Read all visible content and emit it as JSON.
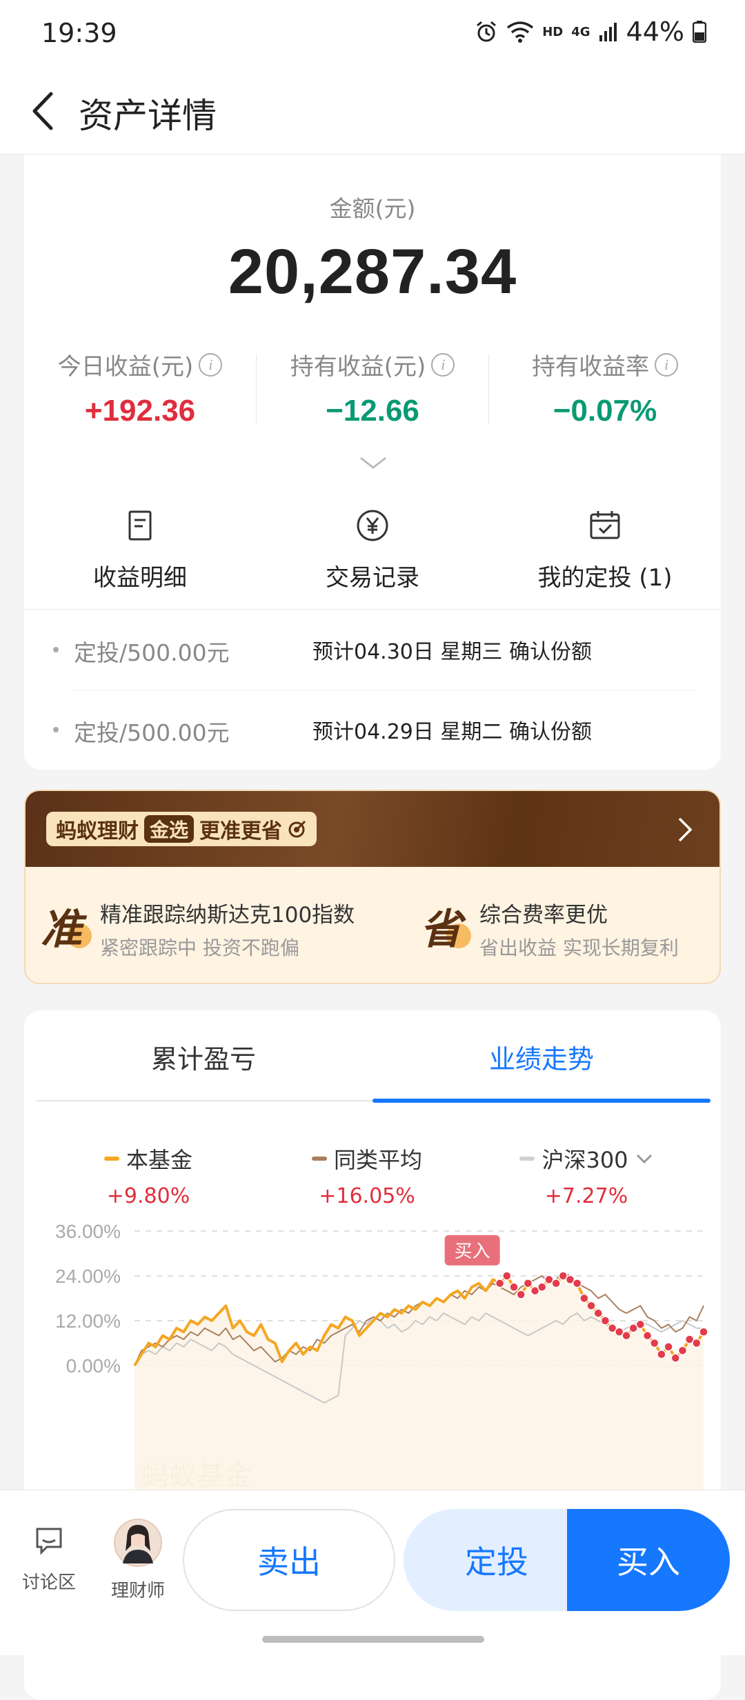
{
  "status": {
    "time": "19:39",
    "hd": "HD",
    "net": "4G",
    "battery": "44%"
  },
  "nav": {
    "title": "资产详情"
  },
  "asset": {
    "amount_label": "金额(元)",
    "amount": "20,287.34",
    "metrics": [
      {
        "label": "今日收益(元)",
        "value": "+192.36",
        "tone": "red"
      },
      {
        "label": "持有收益(元)",
        "value": "−12.66",
        "tone": "green"
      },
      {
        "label": "持有收益率",
        "value": "−0.07%",
        "tone": "green"
      }
    ],
    "actions": [
      {
        "label": "收益明细",
        "icon": "document-icon"
      },
      {
        "label": "交易记录",
        "icon": "yuan-icon"
      },
      {
        "label": "我的定投 (1)",
        "icon": "calendar-check-icon"
      }
    ],
    "plans": [
      {
        "amount": "定投/500.00元",
        "note": "预计04.30日 星期三 确认份额"
      },
      {
        "amount": "定投/500.00元",
        "note": "预计04.29日 星期二 确认份额"
      }
    ]
  },
  "promo": {
    "brand": "蚂蚁理财",
    "badge": "金选",
    "slogan": "更准更省",
    "features": [
      {
        "char": "准",
        "title": "精准跟踪纳斯达克100指数",
        "desc": "紧密跟踪中 投资不跑偏"
      },
      {
        "char": "省",
        "title": "综合费率更优",
        "desc": "省出收益 实现长期复利"
      }
    ]
  },
  "perf": {
    "tabs": [
      "累计盈亏",
      "业绩走势"
    ],
    "active_tab": 1,
    "legend": [
      {
        "name": "本基金",
        "pct": "+9.80%",
        "color": "#f5a623"
      },
      {
        "name": "同类平均",
        "pct": "+16.05%",
        "color": "#a87f5e"
      },
      {
        "name": "沪深300",
        "pct": "+7.27%",
        "color": "#c8c8c8"
      }
    ],
    "buy_marker": "买入",
    "watermark": "蚂蚁基金"
  },
  "chart_data": {
    "type": "line",
    "y_ticks": [
      "36.00%",
      "24.00%",
      "12.00%",
      "0.00%"
    ],
    "ylim": [
      0,
      36
    ],
    "grid": true,
    "series": [
      {
        "name": "本基金",
        "color": "#f5a623",
        "values": [
          0,
          3,
          6,
          5,
          8,
          7,
          10,
          9,
          12,
          11,
          13,
          12,
          14,
          16,
          10,
          12,
          9,
          8,
          11,
          7,
          6,
          1,
          4,
          6,
          3,
          5,
          4,
          8,
          11,
          10,
          13,
          12,
          8,
          10,
          12,
          14,
          13,
          15,
          14,
          16,
          15,
          17,
          16,
          18,
          17,
          19,
          20,
          18,
          21,
          22,
          20,
          23,
          22,
          24,
          21,
          19,
          22,
          20,
          21,
          23,
          22,
          24,
          23,
          22,
          18,
          16,
          14,
          12,
          10,
          9,
          8,
          10,
          11,
          8,
          6,
          3,
          5,
          2,
          4,
          7,
          6,
          9
        ]
      },
      {
        "name": "同类平均",
        "color": "#a87f5e",
        "values": [
          0,
          4,
          5,
          6,
          5,
          7,
          8,
          7,
          9,
          8,
          10,
          9,
          8,
          10,
          7,
          8,
          6,
          4,
          5,
          3,
          1,
          2,
          4,
          3,
          5,
          4,
          7,
          6,
          8,
          9,
          10,
          11,
          9,
          12,
          13,
          12,
          14,
          13,
          15,
          14,
          16,
          17,
          16,
          18,
          17,
          19,
          18,
          20,
          19,
          21,
          20,
          22,
          21,
          20,
          19,
          21,
          22,
          23,
          24,
          22,
          23,
          25,
          24,
          22,
          21,
          20,
          18,
          19,
          17,
          15,
          14,
          15,
          16,
          13,
          12,
          10,
          11,
          9,
          10,
          13,
          12,
          16
        ]
      },
      {
        "name": "沪深300",
        "color": "#c8c8c8",
        "values": [
          0,
          3,
          4,
          3,
          5,
          4,
          6,
          5,
          7,
          6,
          5,
          4,
          6,
          5,
          3,
          2,
          1,
          0,
          -1,
          -2,
          -3,
          -4,
          -5,
          -6,
          -7,
          -8,
          -9,
          -10,
          -9,
          -8,
          8,
          10,
          12,
          11,
          13,
          12,
          10,
          11,
          9,
          10,
          12,
          11,
          13,
          12,
          14,
          13,
          12,
          11,
          13,
          12,
          14,
          13,
          12,
          11,
          10,
          9,
          8,
          9,
          10,
          11,
          12,
          11,
          13,
          14,
          12,
          13,
          12,
          11,
          10,
          9,
          10,
          11,
          12,
          11,
          10,
          9,
          10,
          11,
          12,
          11,
          10,
          10
        ]
      }
    ]
  },
  "bottom": {
    "discuss": "讨论区",
    "advisor": "理财师",
    "sell": "卖出",
    "plan": "定投",
    "buy": "买入"
  }
}
